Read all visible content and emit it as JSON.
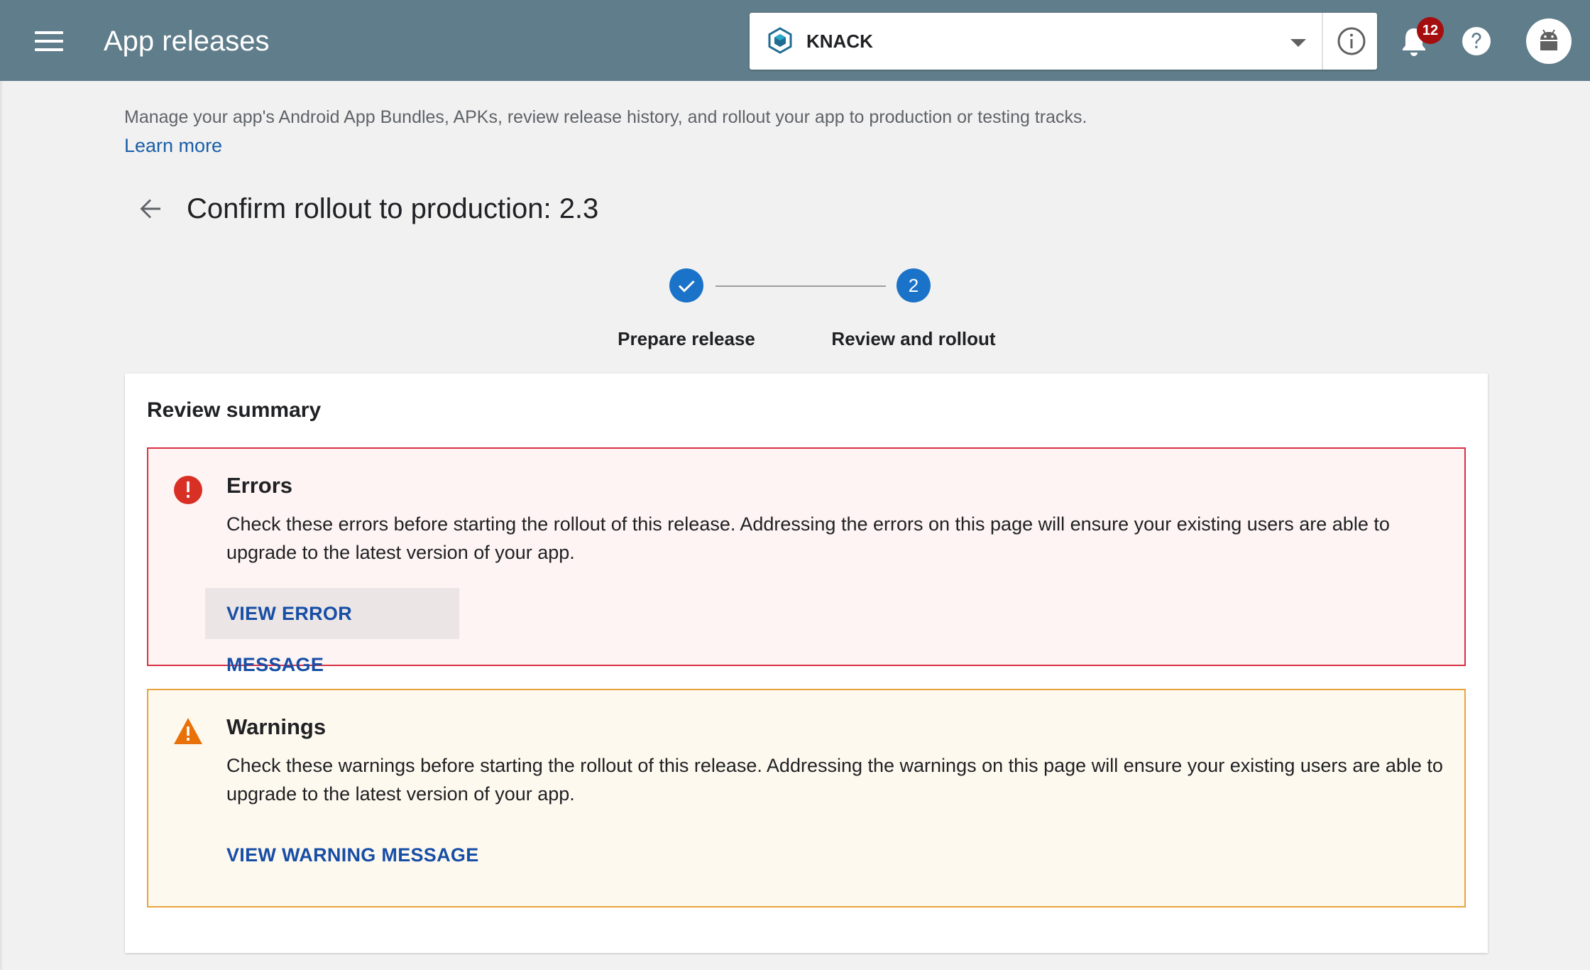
{
  "header": {
    "title": "App releases",
    "app_selector": {
      "app_name": "KNACK"
    },
    "notifications": {
      "count": "12"
    }
  },
  "intro": {
    "description": "Manage your app's Android App Bundles, APKs, review release history, and rollout your app to production or testing tracks.",
    "learn_more": "Learn more"
  },
  "page": {
    "title": "Confirm rollout to production: 2.3"
  },
  "stepper": {
    "steps": [
      {
        "label": "Prepare release",
        "state": "completed"
      },
      {
        "label": "Review and rollout",
        "number": "2",
        "state": "active"
      }
    ]
  },
  "review": {
    "title": "Review summary",
    "errors": {
      "title": "Errors",
      "text": "Check these errors before starting the rollout of this release. Addressing the errors on this page will ensure your existing users are able to upgrade to the latest version of your app.",
      "button": "VIEW ERROR MESSAGE"
    },
    "warnings": {
      "title": "Warnings",
      "text": "Check these warnings before starting the rollout of this release. Addressing the warnings on this page will ensure your existing users are able to upgrade to the latest version of your app.",
      "button": "VIEW WARNING MESSAGE"
    }
  },
  "colors": {
    "topbar": "#607d8b",
    "accent": "#1a73c8",
    "link": "#1a5fa8",
    "error": "#d93045",
    "warning": "#e8a33c",
    "badge": "#a50e0e"
  },
  "icons": [
    "menu-icon",
    "app-logo-icon",
    "chevron-down-icon",
    "info-icon",
    "bell-icon",
    "help-icon",
    "android-avatar-icon",
    "back-arrow-icon",
    "checkmark-icon",
    "error-icon",
    "warning-icon"
  ]
}
